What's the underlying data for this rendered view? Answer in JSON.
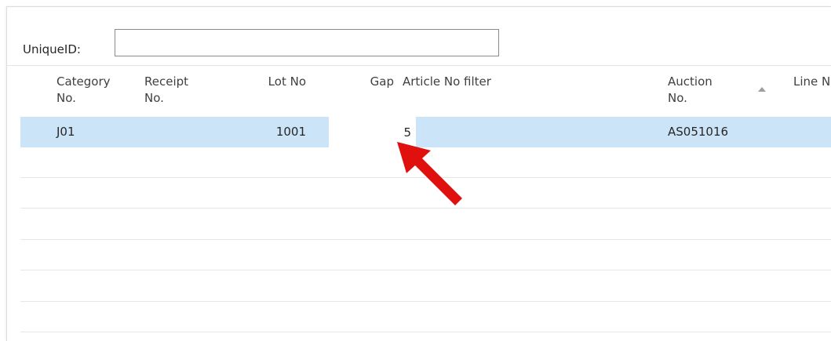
{
  "filter": {
    "label": "UniqueID:",
    "value": ""
  },
  "columns": {
    "category": [
      "Category",
      "No."
    ],
    "receipt": [
      "Receipt",
      "No."
    ],
    "lot": "Lot No",
    "gap": "Gap",
    "article": "Article No filter",
    "auction": [
      "Auction",
      "No."
    ],
    "line": "Line N"
  },
  "sort": {
    "column": "Auction No.",
    "direction": "ascending",
    "icon": "sort-ascending-icon"
  },
  "rows": [
    {
      "category": "J01",
      "receipt": "",
      "lot": "1001",
      "gap": "5",
      "article": "",
      "auction": "AS051016",
      "line": ""
    }
  ],
  "colors": {
    "selected_row": "#cce4f7",
    "arrow": "#e0100e"
  },
  "annotation": {
    "icon": "red-arrow-icon"
  }
}
